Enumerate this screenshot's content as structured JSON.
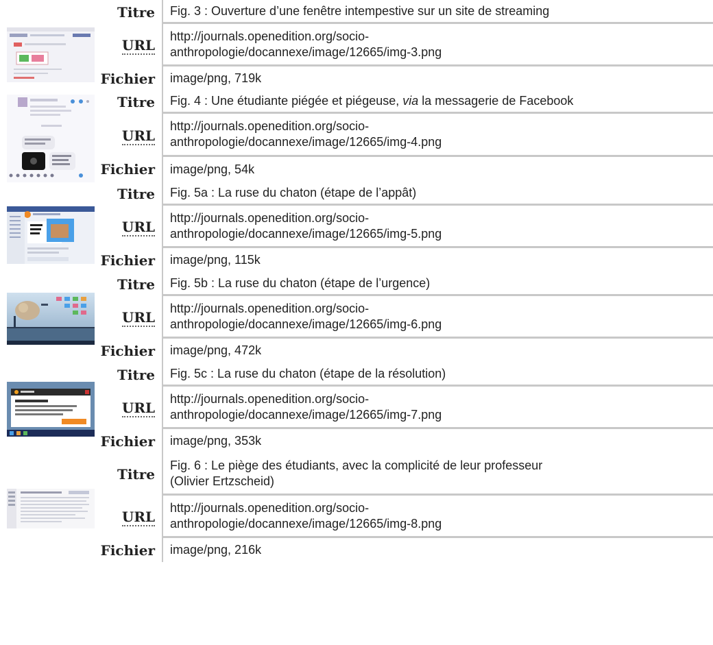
{
  "labels": {
    "titre": "Titre",
    "url": "URL",
    "fichier": "Fichier"
  },
  "entries": [
    {
      "titre": "Fig. 3 : Ouverture d’une fenêtre intempestive sur un site de streaming",
      "url_line1": "http://journals.openedition.org/socio-",
      "url_line2": "anthropologie/docannexe/image/12665/img-3.png",
      "fichier": "image/png, 719k"
    },
    {
      "titre_pre": "Fig. 4 : Une étudiante piégée et piégeuse, ",
      "titre_em": "via",
      "titre_post": " la messagerie de Facebook",
      "url_line1": "http://journals.openedition.org/socio-",
      "url_line2": "anthropologie/docannexe/image/12665/img-4.png",
      "fichier": "image/png, 54k"
    },
    {
      "titre": "Fig. 5a : La ruse du chaton (étape de l’appât)",
      "url_line1": "http://journals.openedition.org/socio-",
      "url_line2": "anthropologie/docannexe/image/12665/img-5.png",
      "fichier": "image/png, 115k"
    },
    {
      "titre": "Fig. 5b : La ruse du chaton (étape de l’urgence)",
      "url_line1": "http://journals.openedition.org/socio-",
      "url_line2": "anthropologie/docannexe/image/12665/img-6.png",
      "fichier": "image/png, 472k"
    },
    {
      "titre": "Fig. 5c : La ruse du chaton (étape de la résolution)",
      "url_line1": "http://journals.openedition.org/socio-",
      "url_line2": "anthropologie/docannexe/image/12665/img-7.png",
      "fichier": "image/png, 353k"
    },
    {
      "titre_line1": "Fig. 6 : Le piège des étudiants, avec la complicité de leur professeur",
      "titre_line2": "(Olivier Ertzscheid)",
      "url_line1": "http://journals.openedition.org/socio-",
      "url_line2": "anthropologie/docannexe/image/12665/img-8.png",
      "fichier": "image/png, 216k"
    }
  ]
}
